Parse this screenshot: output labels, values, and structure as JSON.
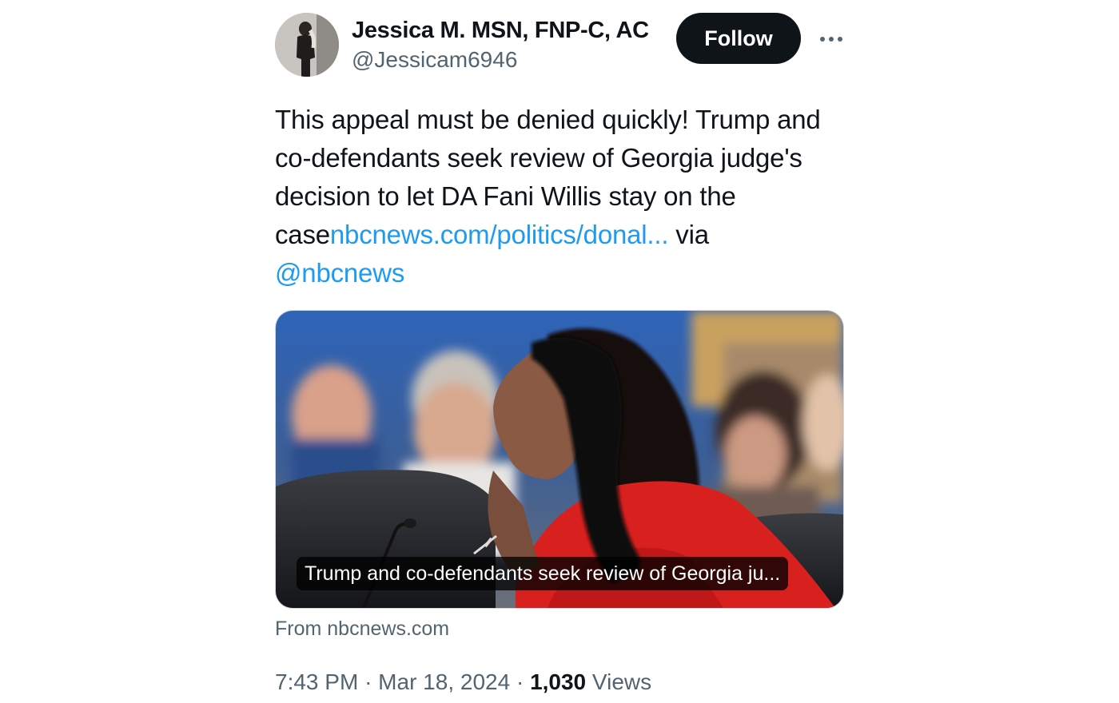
{
  "author": {
    "name": "Jessica M. MSN, FNP-C, AC",
    "handle": "@Jessicam6946"
  },
  "actions": {
    "follow_label": "Follow",
    "more_icon": "more-horizontal-icon"
  },
  "tweet": {
    "text_start": "This appeal must be denied quickly! Trump and co-defendants seek review of Georgia judge's decision to let DA Fani Willis stay on the case",
    "link_text": "nbcnews.com/politics/donal...",
    "via_text": "via",
    "mention": "@nbcnews"
  },
  "card": {
    "headline": "Trump and co-defendants seek review of Georgia ju...",
    "source": "From nbcnews.com"
  },
  "meta": {
    "time": "7:43 PM",
    "separator": "·",
    "date": "Mar 18, 2024",
    "views_count": "1,030",
    "views_label": "Views"
  },
  "colors": {
    "text": "#0f1419",
    "secondary": "#536471",
    "link": "#1d9bf0",
    "button": "#0f1419"
  }
}
